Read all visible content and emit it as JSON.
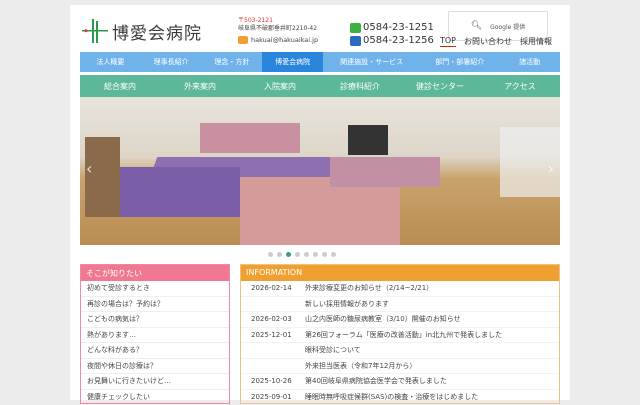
{
  "header": {
    "hospital_name": "博愛会病院",
    "zip": "〒503-2121",
    "address": "岐阜県不破郡垂井町2210-42",
    "email": "hakuai@hakuaikai.jp",
    "tel": "0584-23-1251",
    "fax": "0584-23-1256",
    "search_label": "Google 提供",
    "links": [
      "TOP",
      "お問い合わせ",
      "採用情報"
    ]
  },
  "nav_primary": [
    "法人概要",
    "理事長紹介",
    "理念・方針",
    "博愛会病院",
    "関連施設・サービス",
    "部門・部署紹介",
    "諸活動"
  ],
  "nav_secondary": [
    "総合案内",
    "外来案内",
    "入院案内",
    "診療科紹介",
    "健診センター",
    "アクセス"
  ],
  "carousel": {
    "slide_count": 8,
    "active_index": 2,
    "prev": "‹",
    "next": "›"
  },
  "faq": {
    "title": "そこが知りたい",
    "items": [
      "初めて受診するとき",
      "再診の場合は？予約は？",
      "こどもの病気は？",
      "熱があります…",
      "どんな科がある？",
      "夜間や休日の診療は？",
      "お見舞いに行きたいけど…",
      "健康チェックしたい"
    ]
  },
  "info": {
    "title": "INFORMATION",
    "rows": [
      {
        "date": "2026-02-14",
        "text": "外来診療変更のお知らせ（2/14~2/21）"
      },
      {
        "date": "",
        "text": "新しい採用情報があります"
      },
      {
        "date": "2026-02-03",
        "text": "山之内医師の糖尿病教室（3/10）開催のお知らせ"
      },
      {
        "date": "2025-12-01",
        "text": "第26回フォーラム「医療の改善活動」in北九州で発表しました"
      },
      {
        "date": "",
        "text": "眼科受診について"
      },
      {
        "date": "",
        "text": "外来担当医表（令和7年12月から）"
      },
      {
        "date": "2025-10-26",
        "text": "第40回岐阜県病院協会医学会で発表しました"
      },
      {
        "date": "2025-09-01",
        "text": "睡眠時無呼吸症候群(SAS)の検査・治療をはじめました"
      }
    ]
  }
}
